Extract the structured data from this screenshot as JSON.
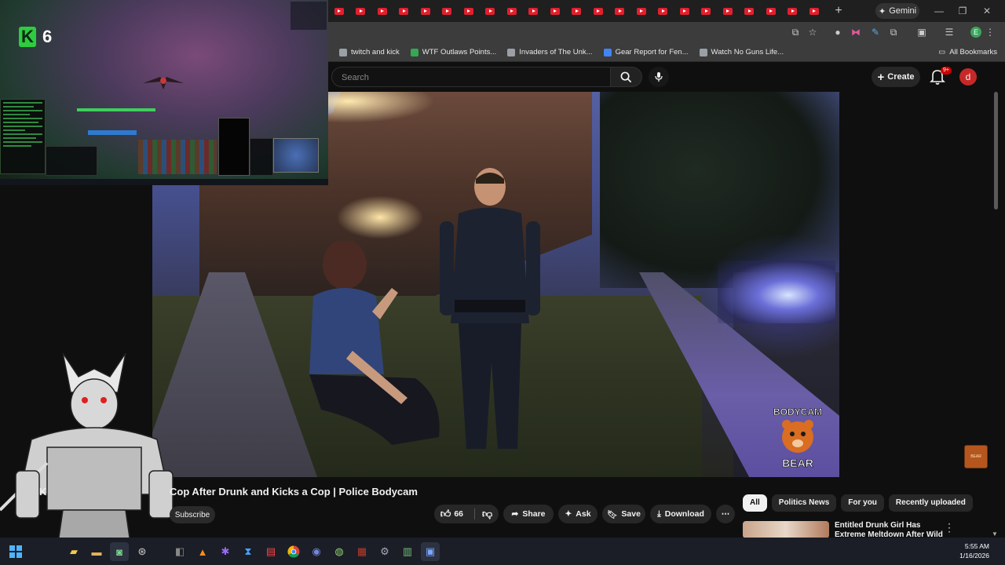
{
  "browser": {
    "tab_count": 23,
    "gemini_label": "Gemini",
    "bookmarks": [
      {
        "label": "twitch and kick",
        "color": "#9aa0a6"
      },
      {
        "label": "WTF Outlaws Points...",
        "color": "#34a853"
      },
      {
        "label": "Invaders of The Unk...",
        "color": "#9aa0a6"
      },
      {
        "label": "Gear Report for Fen...",
        "color": "#4285f4"
      },
      {
        "label": "Watch No Guns Life...",
        "color": "#9aa0a6"
      }
    ],
    "all_bookmarks_label": "All Bookmarks",
    "profile_initial": "E"
  },
  "youtube": {
    "search_placeholder": "Search",
    "create_label": "Create",
    "notifications_badge": "9+",
    "user_initial": "d",
    "video": {
      "title": "Cop After Drunk and Kicks a Cop | Police Bodycam",
      "title_prefix": "K",
      "watermark_line1": "BODYCAM",
      "watermark_line2": "BEAR"
    },
    "subscribe_label": "Subscribe",
    "actions": {
      "like_count": "66",
      "share": "Share",
      "ask": "Ask",
      "save": "Save",
      "download": "Download"
    },
    "chips": [
      "All",
      "Politics News",
      "For you",
      "Recently uploaded"
    ],
    "recommendation": {
      "title": "Entitled Drunk Girl Has Extreme Meltdown After Wild Night"
    }
  },
  "overlay": {
    "counter_letter": "K",
    "counter_value": "6"
  },
  "taskbar": {
    "time": "5:55 AM",
    "date": "1/16/2026"
  },
  "colors": {
    "accent_red": "#cc0000",
    "kick_green": "#2ecc40"
  }
}
